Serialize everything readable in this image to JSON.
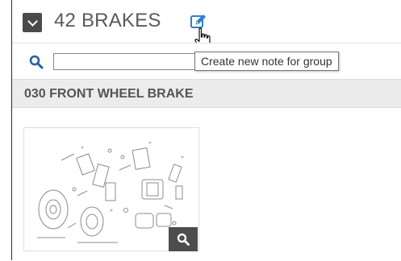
{
  "header": {
    "group_title": "42 BRAKES",
    "collapse_icon": "chevron-down-icon",
    "edit_icon": "edit-note-icon",
    "accent_color": "#2f7fc7"
  },
  "search": {
    "value": "",
    "placeholder": "",
    "icon": "search-icon"
  },
  "tooltip": {
    "text": "Create new note for group"
  },
  "section": {
    "title": "030 FRONT WHEEL BRAKE"
  },
  "thumbnail": {
    "zoom_icon": "magnifier-icon"
  }
}
